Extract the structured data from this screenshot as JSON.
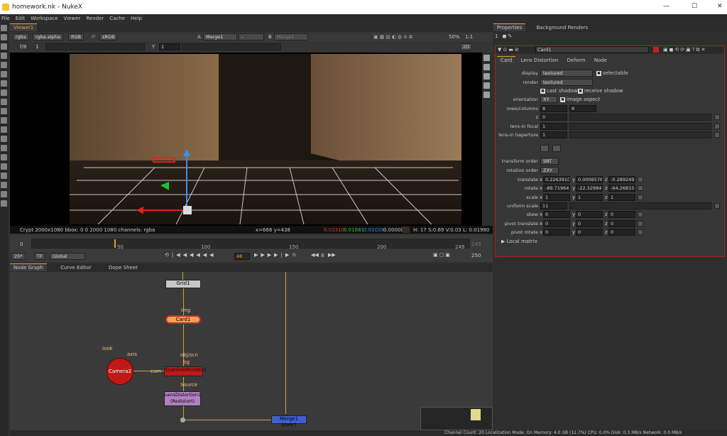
{
  "window": {
    "title": "homework.nk - NukeX",
    "controls": [
      "—",
      "☐",
      "✕"
    ]
  },
  "menu": [
    "File",
    "Edit",
    "Workspace",
    "Viewer",
    "Render",
    "Cache",
    "Help"
  ],
  "viewer": {
    "tab": "Viewer1",
    "channels": "rgba",
    "alpha": "rgba.alpha",
    "rgb": "RGB",
    "ip": "IP",
    "colorspace": "sRGB",
    "inputA_label": "A",
    "inputA": "Merge1",
    "dash": "-",
    "inputB_label": "B",
    "inputB": "Merge1",
    "zoom": "50%",
    "ratio": "1:1",
    "gain_label": "f/8",
    "gain_val": "1",
    "gamma_label": "Y",
    "gamma_val": "1",
    "view_mode": "2D",
    "status": {
      "info": "Crypt 2000x1080  bbox: 0 0 2000 1080 channels: rgba",
      "xy": "x=668 y=438",
      "r": "0.03310",
      "g": "0.01681",
      "b": "0.01039",
      "a": "0.00000",
      "hsv": "H: 17 S:0.69 V:0.03  L: 0.01980"
    }
  },
  "timeline": {
    "start": "0",
    "ticks": [
      "50",
      "100",
      "150",
      "200",
      "249"
    ],
    "end": "249",
    "frame": "48",
    "fps_dd": "25*",
    "tf_dd": "TF",
    "global_dd": "Global",
    "step": "8",
    "end_frame": "250"
  },
  "nodegraph": {
    "tabs": [
      "Node Graph",
      "Curve Editor",
      "Dope Sheet"
    ],
    "nodes": {
      "grid": "Grid1",
      "card": "Card1",
      "camera": "Camera2",
      "scanline": "ScanlineRender2",
      "lens": "LensDistortion1\n(Redistort)",
      "merge": "Merge1 (over)"
    },
    "labels": {
      "img": "img",
      "look": "look",
      "axis": "axis",
      "obj_scn": "obj/scn",
      "bg": "bg",
      "cam": "cam",
      "source": "Source"
    }
  },
  "properties": {
    "tabs": [
      "Properties",
      "Background Renders"
    ],
    "node_name": "Card1",
    "subtabs": [
      "Card",
      "Lens Distortion",
      "Deform",
      "Node"
    ],
    "display": {
      "label": "display",
      "value": "textured",
      "selectable": "selectable"
    },
    "render": {
      "label": "render",
      "value": "textured"
    },
    "cast_shadow": "cast shadow",
    "receive_shadow": "receive shadow",
    "orientation": {
      "label": "orientation",
      "value": "XY",
      "image_aspect": "image aspect"
    },
    "rows_columns": {
      "label": "rows/columns",
      "a": "8",
      "b": "8"
    },
    "z": {
      "label": "z",
      "value": "0"
    },
    "lens_focal": {
      "label": "lens-in focal",
      "value": "1"
    },
    "lens_haperture": {
      "label": "lens-in haperture",
      "value": "1"
    },
    "transform_order": {
      "label": "transform order",
      "value": "SRT"
    },
    "rotation_order": {
      "label": "rotation order",
      "value": "ZXY"
    },
    "translate": {
      "label": "translate",
      "x": "0.22639109",
      "y": "0.00065768",
      "z": "-0.28924939"
    },
    "rotate": {
      "label": "rotate",
      "x": "-89.7196428",
      "y": "-22.3298454",
      "z": "-64.2681503"
    },
    "scale": {
      "label": "scale",
      "x": "1",
      "y": "1",
      "z": "1"
    },
    "uniform_scale": {
      "label": "uniform scale",
      "value": "11"
    },
    "skew": {
      "label": "skew",
      "x": "0",
      "y": "0",
      "z": "0"
    },
    "pivot_translate": {
      "label": "pivot translate",
      "x": "0",
      "y": "0",
      "z": "0"
    },
    "pivot_rotate": {
      "label": "pivot rotate",
      "x": "0",
      "y": "0",
      "z": "0"
    },
    "local_matrix": "Local matrix",
    "axis_labels": {
      "x": "x",
      "y": "y",
      "z": "z"
    }
  },
  "statusbar": "Channel Count: 20  Localization Mode: On  Memory: 4.0 GB (12.7%)  CPU: 0.0%  Disk: 0.3 MB/s  Network: 0.0 MB/s"
}
